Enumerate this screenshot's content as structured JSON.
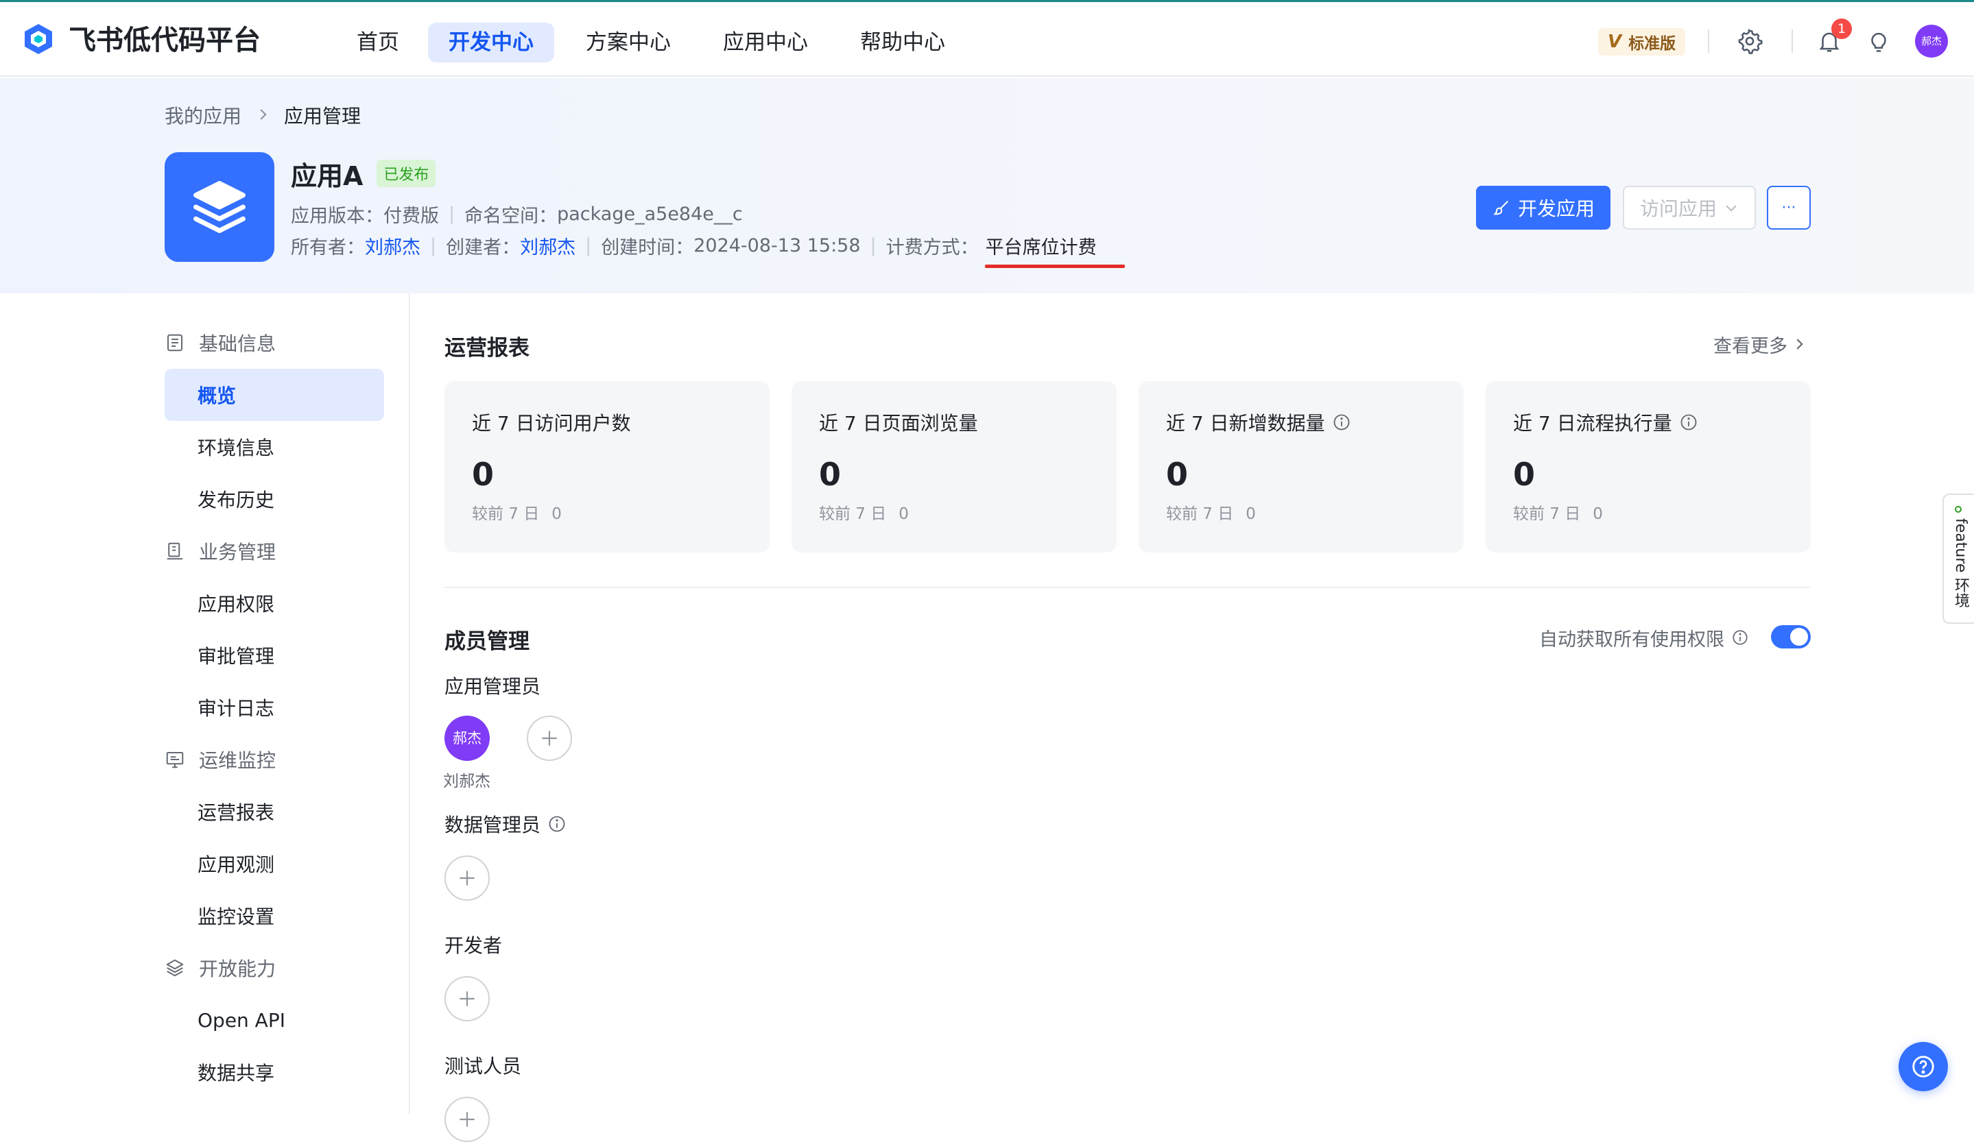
{
  "brand": {
    "name": "飞书低代码平台",
    "primary": "#1456f0"
  },
  "nav": {
    "items": [
      {
        "label": "首页",
        "active": false
      },
      {
        "label": "开发中心",
        "active": true
      },
      {
        "label": "方案中心",
        "active": false
      },
      {
        "label": "应用中心",
        "active": false
      },
      {
        "label": "帮助中心",
        "active": false
      }
    ],
    "edition": {
      "mark": "V",
      "label": "标准版"
    },
    "notification_count": "1",
    "avatar_text": "郝杰"
  },
  "breadcrumb": {
    "parent": "我的应用",
    "current": "应用管理"
  },
  "app": {
    "name": "应用A",
    "status": "已发布",
    "version_label": "应用版本：",
    "version_value": "付费版",
    "namespace_label": "命名空间：",
    "namespace_value": "package_a5e84e__c",
    "owner_label": "所有者：",
    "owner_value": "刘郝杰",
    "creator_label": "创建者：",
    "creator_value": "刘郝杰",
    "created_label": "创建时间：",
    "created_value": "2024-08-13 15:58",
    "billing_label": "计费方式：",
    "billing_value": "平台席位计费"
  },
  "actions": {
    "develop": "开发应用",
    "visit": "访问应用",
    "more": "···"
  },
  "sidebar": {
    "groups": [
      {
        "label": "基础信息",
        "icon": "document-icon",
        "items": [
          {
            "label": "概览",
            "active": true
          },
          {
            "label": "环境信息"
          },
          {
            "label": "发布历史"
          }
        ]
      },
      {
        "label": "业务管理",
        "icon": "business-icon",
        "items": [
          {
            "label": "应用权限"
          },
          {
            "label": "审批管理"
          },
          {
            "label": "审计日志"
          }
        ]
      },
      {
        "label": "运维监控",
        "icon": "monitor-icon",
        "items": [
          {
            "label": "运营报表"
          },
          {
            "label": "应用观测"
          },
          {
            "label": "监控设置"
          }
        ]
      },
      {
        "label": "开放能力",
        "icon": "layers-icon",
        "items": [
          {
            "label": "Open API"
          },
          {
            "label": "数据共享"
          }
        ]
      }
    ]
  },
  "report": {
    "title": "运营报表",
    "more": "查看更多",
    "cards": [
      {
        "label": "近 7 日访问用户数",
        "value": "0",
        "compare_label": "较前 7 日",
        "compare_value": "0",
        "info": false
      },
      {
        "label": "近 7 日页面浏览量",
        "value": "0",
        "compare_label": "较前 7 日",
        "compare_value": "0",
        "info": false
      },
      {
        "label": "近 7 日新增数据量",
        "value": "0",
        "compare_label": "较前 7 日",
        "compare_value": "0",
        "info": true
      },
      {
        "label": "近 7 日流程执行量",
        "value": "0",
        "compare_label": "较前 7 日",
        "compare_value": "0",
        "info": true
      }
    ]
  },
  "members": {
    "title": "成员管理",
    "auto_permission_label": "自动获取所有使用权限",
    "auto_permission_on": true,
    "roles": [
      {
        "label": "应用管理员",
        "members": [
          {
            "avatar": "郝杰",
            "name": "刘郝杰"
          }
        ]
      },
      {
        "label": "数据管理员",
        "info": true
      },
      {
        "label": "开发者"
      },
      {
        "label": "测试人员"
      }
    ]
  },
  "side_tab": {
    "label": "feature 环境",
    "dot_color": "#2ea121"
  }
}
